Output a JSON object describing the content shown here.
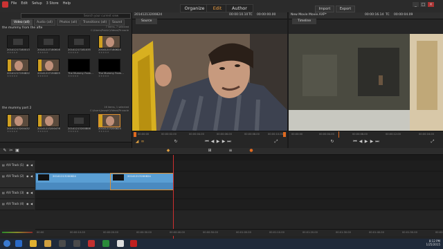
{
  "menu": [
    "File",
    "Edit",
    "Setup",
    "3 Store",
    "Help"
  ],
  "modes": [
    "Organize",
    "Edit",
    "Author"
  ],
  "active_mode": "Edit",
  "top_buttons": {
    "import": "Import",
    "export": "Export"
  },
  "library": {
    "tabs": [
      "Video (all)",
      "Audio (all)",
      "Photos (all)",
      "Transitions (all)",
      "Sound"
    ],
    "search_placeholder": "Search your current view",
    "collection1": {
      "title": "the mummy from the afte",
      "status": "7 items, 7 selected",
      "path": "C:\\Users\\Public\\Videos\\Pinnacle",
      "items": [
        {
          "label": "20141217180013",
          "style": "dark"
        },
        {
          "label": "20141217180616",
          "style": "dark"
        },
        {
          "label": "20141217181035",
          "style": "dark"
        },
        {
          "label": "20141217180624",
          "style": "face"
        },
        {
          "label": "20141217194822",
          "style": "face"
        },
        {
          "label": "20141217194825",
          "style": "face"
        },
        {
          "label": "The Mummy From...",
          "style": "black"
        },
        {
          "label": "The Mummy From...",
          "style": "black"
        }
      ]
    },
    "collection2": {
      "title": "the mummy part 2",
      "status": "16 items, 1 selected",
      "path": "C:\\Users\\Joseph\\Videos\\Pinnacle",
      "items": [
        {
          "label": "20141213200432",
          "style": "face"
        },
        {
          "label": "20141213200476",
          "style": "face"
        },
        {
          "label": "20141213200806",
          "style": "dark"
        },
        {
          "label": "20141213200824",
          "style": "face"
        }
      ]
    }
  },
  "source": {
    "header": "20141213200824",
    "timecode": "00:00:10.10",
    "tc_label": "TC",
    "tc": "00:00:00.00",
    "tab": "Source",
    "marks": [
      "00:00:00",
      "00:00:02.00",
      "00:00:04.00",
      "00:00:06.00",
      "00:00:08.00",
      "00:00:10.00"
    ]
  },
  "timeline_preview": {
    "header": "New Movie Movie.AXP*",
    "timecode": "00:00:16.14",
    "tc_label": "TC",
    "tc": "00:00:04.09",
    "tab": "Timeline",
    "marks": [
      "00:00:00",
      "00:00:04.00",
      "00:00:08.00",
      "00:00:12.00",
      "00:00:16.00"
    ]
  },
  "tracks": [
    {
      "name": "A/V Track (1)"
    },
    {
      "name": "A/V Track (2)"
    },
    {
      "name": "A/V Track (3)"
    },
    {
      "name": "A/V Track (4)"
    }
  ],
  "clips": [
    {
      "name": "20141213200824"
    },
    {
      "name": "20141213200824"
    }
  ],
  "ruler_marks": [
    "00:00",
    "00:00:10.00",
    "00:00:20.00",
    "00:00:30.00",
    "00:00:40.00",
    "00:00:50.00",
    "00:01:00.00",
    "00:01:10.00",
    "00:01:20.00",
    "00:01:30.00",
    "00:01:40.00",
    "00:01:50.00",
    "00:02:00.00"
  ],
  "clock": {
    "time": "8:12 PM",
    "date": "1/25/2015"
  }
}
